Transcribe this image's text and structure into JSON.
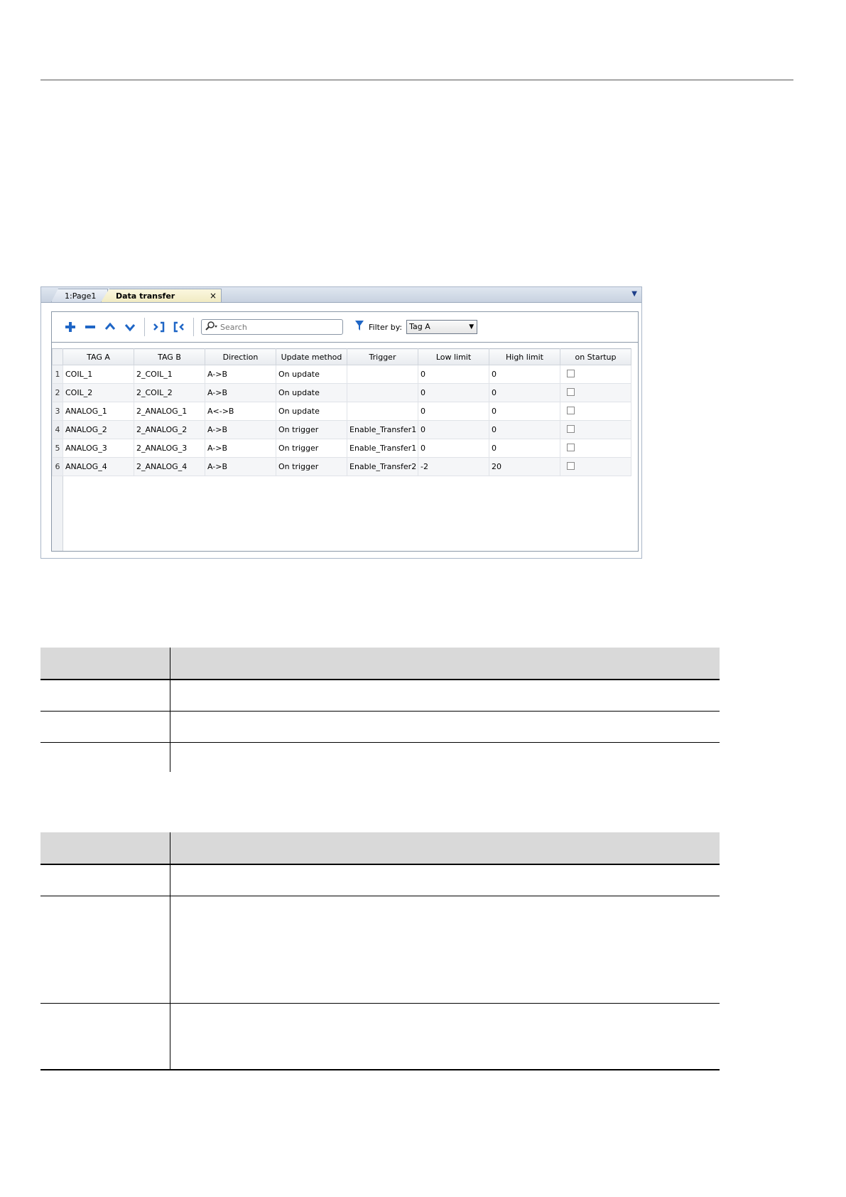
{
  "tabs": [
    {
      "label": "1:Page1"
    },
    {
      "label": "Data transfer",
      "close": "×"
    }
  ],
  "toolbar": {
    "search_placeholder": "Search",
    "filter_label": "Filter by:",
    "filter_value": "Tag A"
  },
  "grid": {
    "columns": [
      "TAG A",
      "TAG B",
      "Direction",
      "Update method",
      "Trigger",
      "Low limit",
      "High limit",
      "on Startup"
    ],
    "rows": [
      {
        "n": "1",
        "tag_a": "COIL_1",
        "tag_b": "2_COIL_1",
        "direction": "A->B",
        "update": "On update",
        "trigger": "",
        "low": "0",
        "high": "0"
      },
      {
        "n": "2",
        "tag_a": "COIL_2",
        "tag_b": "2_COIL_2",
        "direction": "A->B",
        "update": "On update",
        "trigger": "",
        "low": "0",
        "high": "0"
      },
      {
        "n": "3",
        "tag_a": "ANALOG_1",
        "tag_b": "2_ANALOG_1",
        "direction": "A<->B",
        "update": "On update",
        "trigger": "",
        "low": "0",
        "high": "0"
      },
      {
        "n": "4",
        "tag_a": "ANALOG_2",
        "tag_b": "2_ANALOG_2",
        "direction": "A->B",
        "update": "On trigger",
        "trigger": "Enable_Transfer1",
        "low": "0",
        "high": "0"
      },
      {
        "n": "5",
        "tag_a": "ANALOG_3",
        "tag_b": "2_ANALOG_3",
        "direction": "A->B",
        "update": "On trigger",
        "trigger": "Enable_Transfer1",
        "low": "0",
        "high": "0"
      },
      {
        "n": "6",
        "tag_a": "ANALOG_4",
        "tag_b": "2_ANALOG_4",
        "direction": "A->B",
        "update": "On trigger",
        "trigger": "Enable_Transfer2",
        "low": "-2",
        "high": "20"
      }
    ]
  },
  "colors": {
    "accent": "#1f66c6",
    "active_tab": "#f1ebc3",
    "table_header": "#d9d9d9"
  }
}
